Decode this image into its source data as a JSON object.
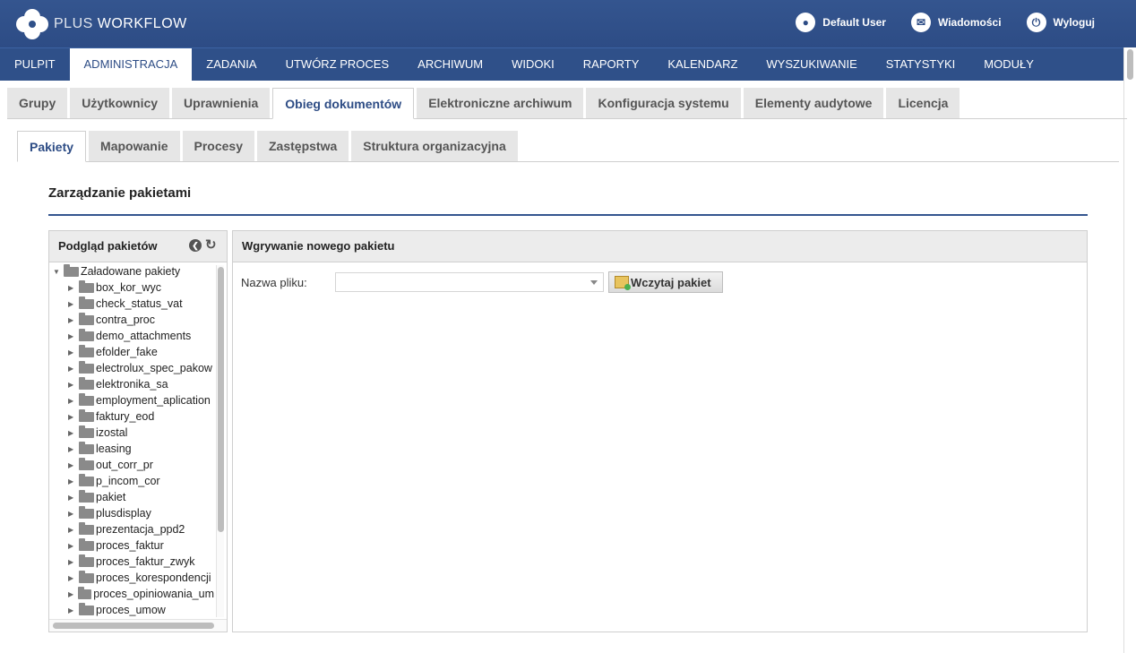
{
  "brand": {
    "logo_plus": "PLUS",
    "logo_workflow": "WORKFLOW"
  },
  "user_links": [
    {
      "label": "Default User",
      "icon": "user-icon"
    },
    {
      "label": "Wiadomości",
      "icon": "mail-icon"
    },
    {
      "label": "Wyloguj",
      "icon": "power-icon"
    }
  ],
  "main_nav": {
    "items": [
      "PULPIT",
      "ADMINISTRACJA",
      "ZADANIA",
      "UTWÓRZ PROCES",
      "ARCHIWUM",
      "WIDOKI",
      "RAPORTY",
      "KALENDARZ",
      "WYSZUKIWANIE",
      "STATYSTYKI",
      "MODUŁY"
    ],
    "active": "ADMINISTRACJA"
  },
  "admin_tabs": {
    "items": [
      "Grupy",
      "Użytkownicy",
      "Uprawnienia",
      "Obieg dokumentów",
      "Elektroniczne archiwum",
      "Konfiguracja systemu",
      "Elementy audytowe",
      "Licencja"
    ],
    "active": "Obieg dokumentów"
  },
  "sub_tabs": {
    "items": [
      "Pakiety",
      "Mapowanie",
      "Procesy",
      "Zastępstwa",
      "Struktura organizacyjna"
    ],
    "active": "Pakiety"
  },
  "section": {
    "title": "Zarządzanie pakietami"
  },
  "left_panel": {
    "title": "Podgląd pakietów",
    "root_label": "Załadowane pakiety",
    "packages": [
      "box_kor_wyc",
      "check_status_vat",
      "contra_proc",
      "demo_attachments",
      "efolder_fake",
      "electrolux_spec_pakow",
      "elektronika_sa",
      "employment_aplication",
      "faktury_eod",
      "izostal",
      "leasing",
      "out_corr_pr",
      "p_incom_cor",
      "pakiet",
      "plusdisplay",
      "prezentacja_ppd2",
      "proces_faktur",
      "proces_faktur_zwyk",
      "proces_korespondencji",
      "proces_opiniowania_um",
      "proces_umow"
    ]
  },
  "right_panel": {
    "title": "Wgrywanie nowego pakietu",
    "file_label": "Nazwa pliku:",
    "file_value": "",
    "load_button": "Wczytaj pakiet"
  }
}
